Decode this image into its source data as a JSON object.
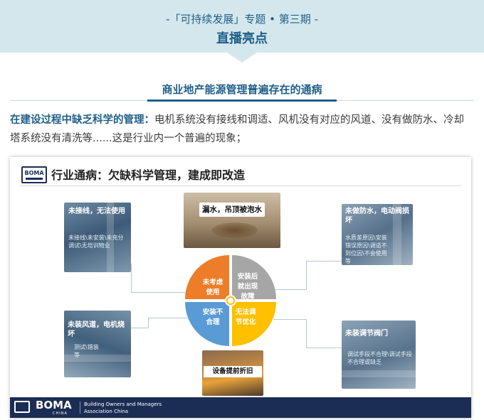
{
  "header": {
    "series": "-「可持续发展」专题 • 第三期 -",
    "headline": "直播亮点"
  },
  "section": {
    "title": "商业地产能源管理普遍存在的通病"
  },
  "paragraph": {
    "lead": "在建设过程中缺乏科学的管理：",
    "body": "电机系统没有接线和调适、风机没有对应的风道、没有做防水、冷却塔系统没有清洗等......这是行业内一个普遍的现象；"
  },
  "slide": {
    "logo_text": "BOMA",
    "title": "行业通病：欠缺科学管理，建成即改造",
    "photos": {
      "top_left": {
        "caption": "未接线，无法使用",
        "note": "未接线\\未安装\\未充分调试\\无培训物业"
      },
      "top": {
        "caption": "漏水，吊顶被泡水"
      },
      "top_right": {
        "caption": "未做防水，电动阀损坏",
        "note": "水质差原因\\安装错误原因\\调适不到位因\\不会使用等"
      },
      "mid_left": {
        "caption": "未装风道，电机烧坏",
        "note": "测试\\错装等"
      },
      "bottom": {
        "caption": "设备提前折旧"
      },
      "mid_right": {
        "caption": "未装调节阀门",
        "note": "调试手段不合理\\调试手段不合理或缺乏"
      }
    },
    "pie": {
      "segments": [
        {
          "label": "未考虑使用",
          "color": "#ee7d2a"
        },
        {
          "label": "安装后就出现故障",
          "color": "#a6a6a6"
        },
        {
          "label": "安装不合理",
          "color": "#5b9bd5"
        },
        {
          "label": "无法调节优化",
          "color": "#ffc000"
        }
      ]
    },
    "footer": {
      "logo": "BOMA",
      "china": "CHINA",
      "org": "Building Owners and Managers Association China"
    }
  }
}
